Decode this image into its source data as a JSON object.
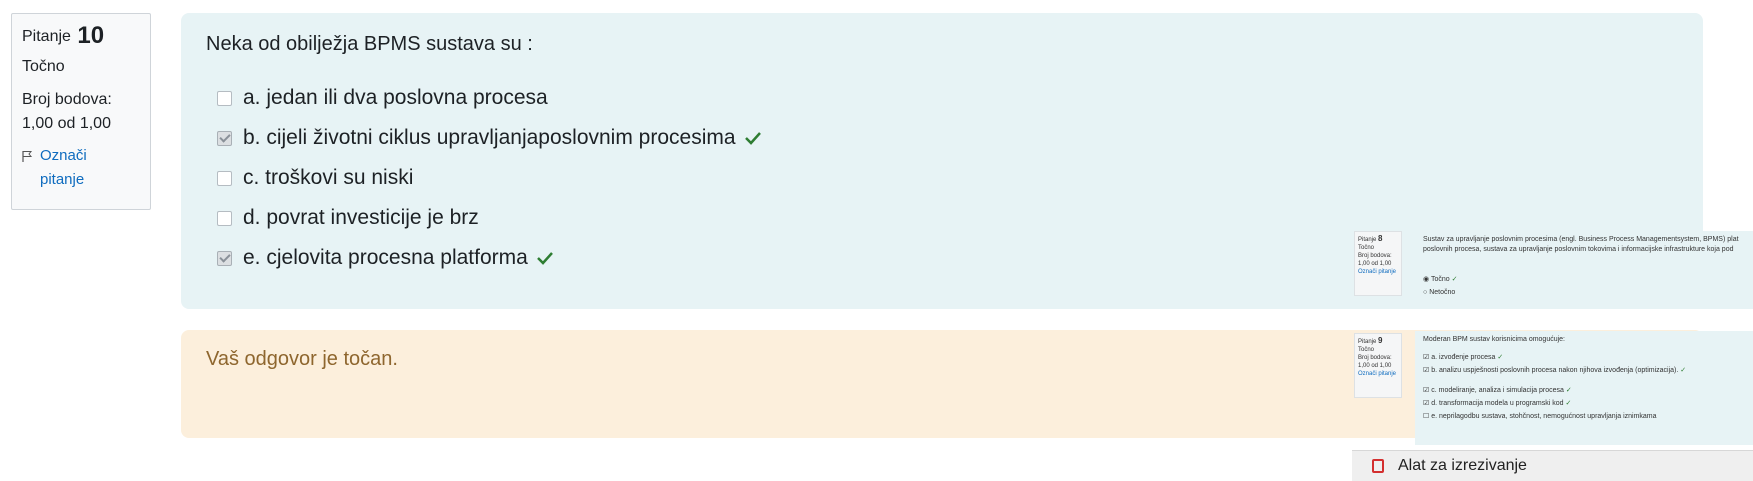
{
  "question_info": {
    "label": "Pitanje",
    "number": "10",
    "state": "Točno",
    "grade_label": "Broj bodova:",
    "grade_value": "1,00 od 1,00",
    "flag_line1": "Označi",
    "flag_line2": "pitanje"
  },
  "question": {
    "text": "Neka od obilježja BPMS sustava su :",
    "answers": [
      {
        "label": "a. jedan ili dva poslovna procesa",
        "checked": false,
        "correct": false
      },
      {
        "label": "b. cijeli životni ciklus upravljanjaposlovnim procesima",
        "checked": true,
        "correct": true
      },
      {
        "label": "c. troškovi su niski",
        "checked": false,
        "correct": false
      },
      {
        "label": "d. povrat investicije je brz",
        "checked": false,
        "correct": false
      },
      {
        "label": "e. cjelovita procesna platforma",
        "checked": true,
        "correct": true
      }
    ]
  },
  "feedback": "Vaš odgovor je točan.",
  "snip_preview": {
    "q8": {
      "label": "Pitanje",
      "number": "8",
      "state": "Točno",
      "grade_label": "Broj bodova:",
      "grade_value": "1,00 od 1,00",
      "flag": "Označi pitanje",
      "text_line1": "Sustav za upravljanje poslovnim procesima (engl. Business Process Managementsystem, BPMS) plat",
      "text_line2": "poslovnih procesa, sustava za upravljanje poslovnim tokovima i informacijske infrastrukture koja pod",
      "options": [
        "Točno",
        "Netočno"
      ]
    },
    "q9": {
      "label": "Pitanje",
      "number": "9",
      "state": "Točno",
      "grade_label": "Broj bodova:",
      "grade_value": "1,00 od 1,00",
      "flag": "Označi pitanje",
      "text": "Moderan BPM sustav korisnicima omogućuje:",
      "options": [
        "a. izvođenje procesa",
        "b. analizu uspješnosti poslovnih procesa nakon njihova izvođenja (optimizacija).",
        "c. modeliranje, analiza i simulacija procesa",
        "d. transformacija modela u programski kod",
        "e. neprilagodbu sustava, stohčnost, nemogućnost upravljanja iznimkama"
      ]
    }
  },
  "snipping_tool": {
    "title": "Alat za izrezivanje"
  },
  "colors": {
    "formulation_bg": "#e7f3f5",
    "outcome_bg": "#fcefdc",
    "correct_tick": "#2e7d32",
    "link": "#0f6cbf",
    "feedback_text": "#8e662e"
  }
}
